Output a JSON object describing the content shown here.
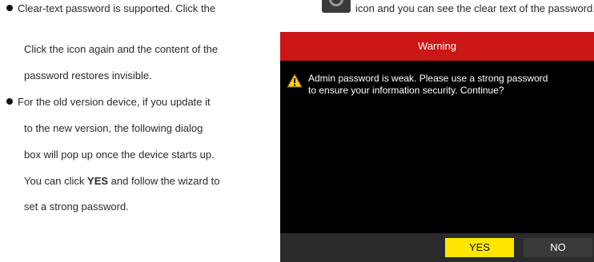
{
  "doc": {
    "bullet1": {
      "text_before_icon": "Clear-text password is supported. Click the",
      "text_after_icon": "icon and you can see the clear text of the password.",
      "line2": "Click the icon again and the content of the",
      "line3": "password restores invisible."
    },
    "bullet2": {
      "line1": "For the old version device, if you update it",
      "line2": "to the new version, the following dialog",
      "line3": "box will pop up once the device starts up.",
      "line4_before_bold": "You can click",
      "line4_bold": "YES",
      "line4_after_bold": "and follow the wizard to",
      "line5": "set a strong password."
    },
    "icons": {
      "inline_icon": "eye-icon",
      "dialog_icon": "warning-icon"
    }
  },
  "dialog": {
    "title": "Warning",
    "message_line1": "Admin password is weak. Please use a strong password",
    "message_line2": "to ensure your information security. Continue?",
    "yes_label": "YES",
    "no_label": "NO",
    "colors": {
      "title_bar": "#cc1515",
      "body": "#000000",
      "footer": "#2b2b2b",
      "yes_button": "#ffe600",
      "no_button": "#3a3a3a"
    }
  }
}
